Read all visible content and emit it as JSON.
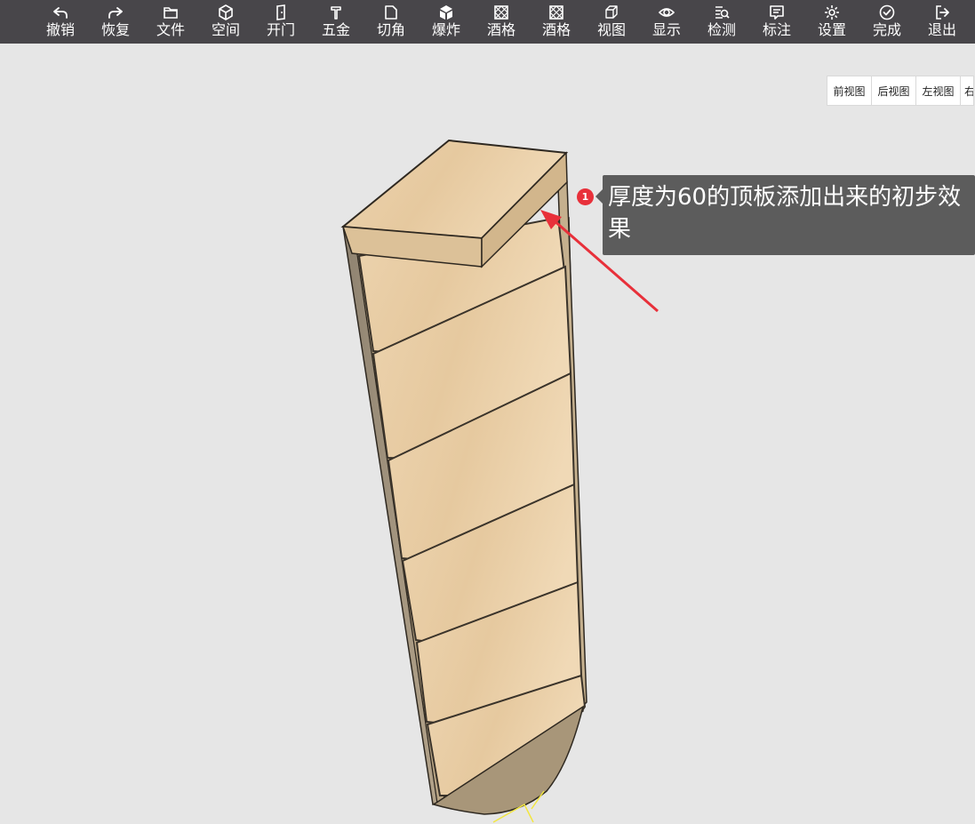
{
  "toolbar": {
    "items": [
      {
        "label": "撤销",
        "icon": "undo-icon"
      },
      {
        "label": "恢复",
        "icon": "redo-icon"
      },
      {
        "label": "文件",
        "icon": "folder-icon"
      },
      {
        "label": "空间",
        "icon": "cube-icon"
      },
      {
        "label": "开门",
        "icon": "door-icon"
      },
      {
        "label": "五金",
        "icon": "hardware-icon"
      },
      {
        "label": "切角",
        "icon": "corner-cut-icon"
      },
      {
        "label": "爆炸",
        "icon": "explode-icon"
      },
      {
        "label": "酒格",
        "icon": "wine-rack-icon"
      },
      {
        "label": "酒格",
        "icon": "wine-rack-icon"
      },
      {
        "label": "视图",
        "icon": "view-cube-icon"
      },
      {
        "label": "显示",
        "icon": "eye-icon"
      },
      {
        "label": "检测",
        "icon": "inspect-icon"
      },
      {
        "label": "标注",
        "icon": "annotation-icon"
      },
      {
        "label": "设置",
        "icon": "gear-icon"
      },
      {
        "label": "完成",
        "icon": "check-circle-icon"
      },
      {
        "label": "退出",
        "icon": "exit-icon"
      }
    ]
  },
  "view_buttons": [
    "前视图",
    "后视图",
    "左视图",
    "右"
  ],
  "annotation": {
    "badge": "1",
    "text": "厚度为60的顶板添加出来的初步效果",
    "color": "#e8303a"
  },
  "colors": {
    "toolbar_bg": "#48464a",
    "canvas_bg": "#e6e6e6",
    "wood_light": "#e8cda6",
    "wood_edge": "#c9ad86",
    "cabinet_side": "#9b8d78",
    "callout_bg": "#5c5c5c"
  }
}
